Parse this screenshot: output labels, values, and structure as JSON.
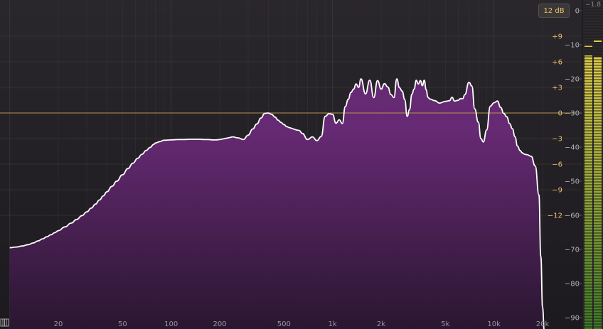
{
  "range_button": {
    "label": "12 dB"
  },
  "meter": {
    "peak_readout": "−1.8"
  },
  "axes": {
    "freq_labels": [
      {
        "label": "20",
        "hz": 20
      },
      {
        "label": "50",
        "hz": 50
      },
      {
        "label": "100",
        "hz": 100
      },
      {
        "label": "200",
        "hz": 200
      },
      {
        "label": "500",
        "hz": 500
      },
      {
        "label": "1k",
        "hz": 1000
      },
      {
        "label": "2k",
        "hz": 2000
      },
      {
        "label": "5k",
        "hz": 5000
      },
      {
        "label": "10k",
        "hz": 10000
      },
      {
        "label": "20k",
        "hz": 20000
      }
    ],
    "eq_gain_labels": [
      {
        "label": "+9",
        "db": 9
      },
      {
        "label": "+6",
        "db": 6
      },
      {
        "label": "+3",
        "db": 3
      },
      {
        "label": "0",
        "db": 0
      },
      {
        "label": "-3",
        "db": -3
      },
      {
        "label": "-6",
        "db": -6
      },
      {
        "label": "-9",
        "db": -9
      },
      {
        "label": "-12",
        "db": -12
      }
    ],
    "spectrum_db_labels": [
      {
        "label": "0",
        "db": 0
      },
      {
        "label": "-10",
        "db": -10
      },
      {
        "label": "-20",
        "db": -20
      },
      {
        "label": "-30",
        "db": -30
      },
      {
        "label": "-40",
        "db": -40
      },
      {
        "label": "-50",
        "db": -50
      },
      {
        "label": "-60",
        "db": -60
      },
      {
        "label": "-70",
        "db": -70
      },
      {
        "label": "-80",
        "db": -80
      },
      {
        "label": "-90",
        "db": -90
      }
    ]
  },
  "colors": {
    "background": "#201d22",
    "fill_top": "#6a2a78",
    "fill_bottom": "#2a1630",
    "curve": "#ffffff",
    "zero_line": "#b8924a",
    "gain_label": "#e8c170",
    "db_label": "#b5b2b8",
    "freq_label": "#9a979d",
    "grid": "#3a373c",
    "meter_green": "#4c8a2a",
    "meter_yellow": "#d8c040"
  },
  "chart_data": {
    "type": "area",
    "x_scale": "log",
    "xlim": [
      10,
      22000
    ],
    "ylim": [
      -95,
      0
    ],
    "xlabel": "",
    "ylabel": "",
    "series": [
      {
        "x": [
          10,
          11,
          12,
          13,
          14,
          15,
          16,
          17,
          18,
          19,
          20,
          22,
          24,
          26,
          28,
          30,
          32,
          34,
          36,
          38,
          40,
          43,
          46,
          50,
          54,
          58,
          62,
          66,
          70,
          74,
          78,
          80,
          85,
          90,
          100,
          110,
          120,
          130,
          140,
          150,
          160,
          170,
          180,
          190,
          200,
          210,
          220,
          230,
          240,
          260,
          280,
          300,
          320,
          340,
          360,
          380,
          400,
          420,
          440,
          460,
          480,
          500,
          520,
          540,
          560,
          580,
          600,
          620,
          650,
          700,
          750,
          800,
          850,
          900,
          950,
          1000,
          1050,
          1100,
          1150,
          1200,
          1250,
          1300,
          1350,
          1400,
          1450,
          1500,
          1600,
          1700,
          1800,
          1900,
          2000,
          2100,
          2200,
          2300,
          2400,
          2500,
          2600,
          2700,
          2800,
          2900,
          3000,
          3100,
          3200,
          3300,
          3400,
          3500,
          3600,
          3700,
          3800,
          3900,
          4000,
          4300,
          4600,
          5000,
          5300,
          5500,
          5700,
          6000,
          6200,
          6400,
          6600,
          7000,
          7300,
          7600,
          8000,
          8300,
          8600,
          9000,
          9500,
          10000,
          10500,
          11000,
          11500,
          12000,
          12500,
          13000,
          13500,
          14000,
          14500,
          15000,
          15500,
          16000,
          17000,
          18000,
          19000,
          19500,
          20000,
          20500,
          21000,
          22000
        ],
        "y": [
          -69.5,
          -69.3,
          -69.0,
          -68.6,
          -68.1,
          -67.5,
          -66.9,
          -66.3,
          -65.7,
          -65.1,
          -64.5,
          -63.4,
          -62.3,
          -61.2,
          -60.1,
          -59.0,
          -57.9,
          -56.7,
          -55.5,
          -54.3,
          -53.1,
          -51.5,
          -50.0,
          -48.1,
          -46.3,
          -44.7,
          -43.3,
          -42.1,
          -41.0,
          -40.1,
          -39.2,
          -38.8,
          -38.4,
          -38.0,
          -37.9,
          -37.8,
          -37.8,
          -37.7,
          -37.7,
          -37.7,
          -37.8,
          -37.8,
          -37.9,
          -37.9,
          -37.8,
          -37.6,
          -37.4,
          -37.2,
          -37.0,
          -37.3,
          -37.8,
          -36.5,
          -34.7,
          -33.2,
          -31.5,
          -30.1,
          -30.0,
          -30.4,
          -31.2,
          -32.1,
          -32.8,
          -33.4,
          -34.0,
          -34.3,
          -34.5,
          -34.8,
          -35.0,
          -35.1,
          -36.0,
          -37.8,
          -37.0,
          -38.1,
          -36.9,
          -31.0,
          -30.2,
          -30.4,
          -33.0,
          -32.0,
          -33.1,
          -28.1,
          -26.0,
          -24.0,
          -23.0,
          -21.5,
          -22.5,
          -20.0,
          -24.4,
          -20.4,
          -25.5,
          -20.5,
          -23.0,
          -21.4,
          -22.4,
          -24.6,
          -25.5,
          -20.0,
          -22.6,
          -23.6,
          -26.1,
          -31.0,
          -29.0,
          -24.5,
          -23.0,
          -20.4,
          -21.5,
          -20.5,
          -22.0,
          -20.4,
          -23.2,
          -25.4,
          -25.9,
          -26.4,
          -27.1,
          -26.6,
          -26.4,
          -25.4,
          -26.5,
          -26.3,
          -25.8,
          -25.8,
          -24.6,
          -21.0,
          -22.1,
          -28.8,
          -32.7,
          -37.5,
          -38.5,
          -35.0,
          -28.0,
          -27.0,
          -26.5,
          -28.4,
          -30.1,
          -31.1,
          -33.1,
          -34.6,
          -37.0,
          -39.7,
          -41.0,
          -41.7,
          -42.1,
          -42.2,
          -42.7,
          -45.5,
          -54.0,
          -72.0,
          -87.0,
          -94.0,
          -95.0,
          -95.0
        ]
      }
    ]
  }
}
